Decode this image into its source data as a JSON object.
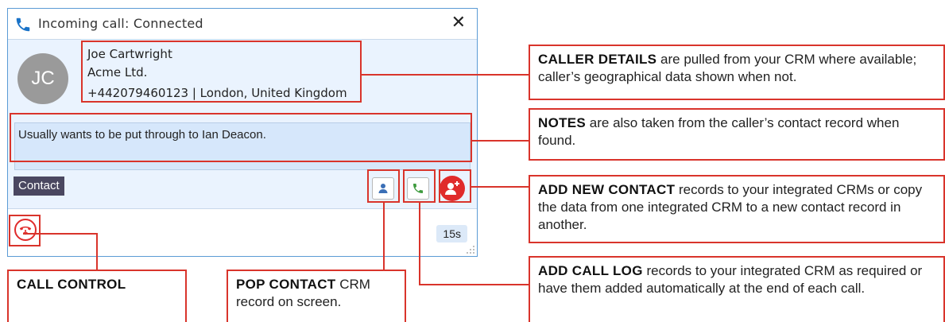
{
  "window": {
    "title": "Incoming call: Connected",
    "close_label": "✕"
  },
  "caller": {
    "initials": "JC",
    "name": "Joe Cartwright",
    "company": "Acme Ltd.",
    "phone_location": "+442079460123 | London, United Kingdom"
  },
  "notes": "Usually wants to be put through to Ian Deacon.",
  "contact_button": "Contact",
  "timer": "15s",
  "annotations": {
    "caller_details": {
      "lead": "CALLER DETAILS",
      "text": " are pulled from your CRM where available; caller’s geographical data shown when not."
    },
    "notes": {
      "lead": "NOTES",
      "text": " are also taken from the caller’s contact record when found."
    },
    "add_contact": {
      "lead": "ADD NEW CONTACT",
      "text": " records to your integrated CRMs or copy the data from one integrated CRM to a new contact record in another."
    },
    "add_call_log": {
      "lead": "ADD CALL LOG",
      "text": " records to your integrated CRM as required or have them added automatically at the end of each call."
    },
    "call_control": {
      "lead": "CALL CONTROL",
      "text": ""
    },
    "pop_contact": {
      "lead": "POP CONTACT",
      "text": " CRM record on screen."
    }
  },
  "colors": {
    "accent_red": "#d9342b",
    "window_border": "#5b9bd5",
    "body_bg": "#eaf3fe",
    "contact_button_bg": "#4a4760"
  }
}
